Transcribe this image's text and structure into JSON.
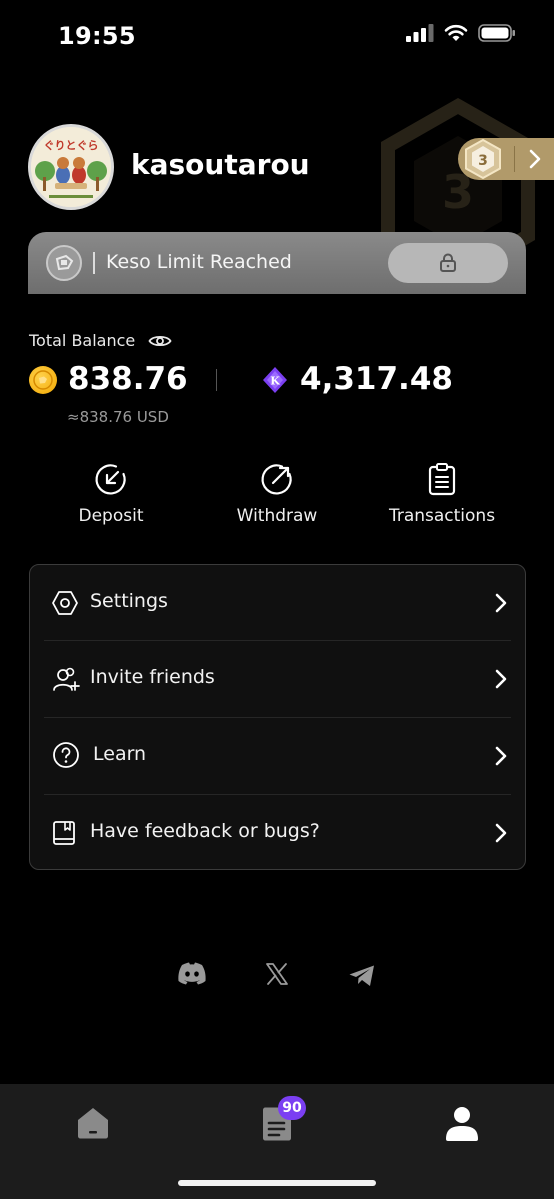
{
  "status_bar": {
    "time": "19:55"
  },
  "profile": {
    "username": "kasoutarou",
    "level": "3",
    "avatar_text": "ぐりとぐら"
  },
  "keso_banner": {
    "text": "Keso Limit Reached"
  },
  "balance": {
    "label": "Total Balance",
    "coin_amount": "838.76",
    "usd_equivalent": "≈838.76 USD",
    "k_amount": "4,317.48",
    "k_symbol": "K"
  },
  "actions": [
    {
      "label": "Deposit",
      "icon": "deposit-arrow-icon"
    },
    {
      "label": "Withdraw",
      "icon": "withdraw-arrow-icon"
    },
    {
      "label": "Transactions",
      "icon": "clipboard-icon"
    }
  ],
  "menu": [
    {
      "label": "Settings",
      "icon": "hexagon-settings-icon"
    },
    {
      "label": "Invite friends",
      "icon": "add-user-icon"
    },
    {
      "label": "Learn",
      "icon": "question-circle-icon"
    },
    {
      "label": "Have feedback or bugs?",
      "icon": "book-icon"
    }
  ],
  "socials": [
    "discord-icon",
    "x-icon",
    "telegram-icon"
  ],
  "bottom_nav": {
    "items": [
      "home-icon",
      "tasks-icon",
      "profile-icon"
    ],
    "tasks_badge": "90"
  },
  "colors": {
    "background": "#000000",
    "level_badge": "#b19a6a",
    "keso_banner": "#7a7a7a",
    "coin": "#f2a600",
    "k_token": "#7b3ff2",
    "badge": "#7b3ff2"
  }
}
